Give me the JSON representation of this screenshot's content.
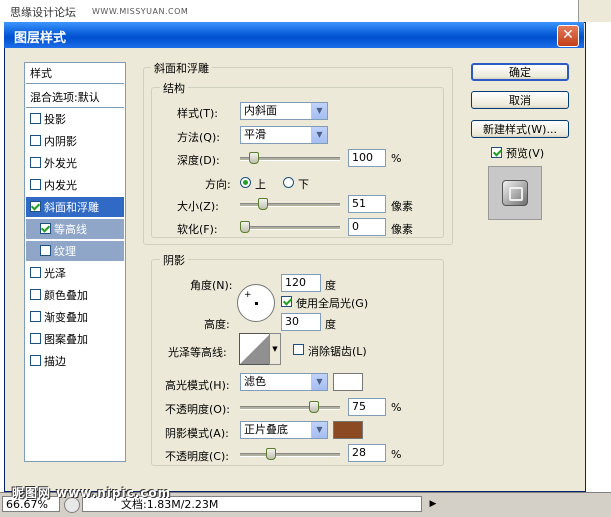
{
  "watermark": {
    "left": "思缘设计论坛",
    "right": "WWW.MISSYUAN.COM"
  },
  "dialog": {
    "title": "图层样式",
    "close_glyph": "✕"
  },
  "style_list": {
    "header": "样式",
    "blend": "混合选项:默认",
    "items": [
      {
        "label": "投影",
        "checked": false
      },
      {
        "label": "内阴影",
        "checked": false
      },
      {
        "label": "外发光",
        "checked": false
      },
      {
        "label": "内发光",
        "checked": false
      },
      {
        "label": "斜面和浮雕",
        "checked": true
      },
      {
        "label": "等高线",
        "checked": true
      },
      {
        "label": "纹理",
        "checked": false
      },
      {
        "label": "光泽",
        "checked": false
      },
      {
        "label": "颜色叠加",
        "checked": false
      },
      {
        "label": "渐变叠加",
        "checked": false
      },
      {
        "label": "图案叠加",
        "checked": false
      },
      {
        "label": "描边",
        "checked": false
      }
    ]
  },
  "buttons": {
    "ok": "确定",
    "cancel": "取消",
    "new_style": "新建样式(W)...",
    "preview": "预览(V)"
  },
  "bevel": {
    "group_title": "斜面和浮雕",
    "structure_title": "结构",
    "style_label": "样式(T):",
    "style_value": "内斜面",
    "technique_label": "方法(Q):",
    "technique_value": "平滑",
    "depth_label": "深度(D):",
    "depth_value": "100",
    "depth_unit": "%",
    "depth_level": 0.1,
    "direction_label": "方向:",
    "direction_up": "上",
    "direction_down": "下",
    "size_label": "大小(Z):",
    "size_value": "51",
    "size_unit": "像素",
    "size_level": 0.2,
    "soften_label": "软化(F):",
    "soften_value": "0",
    "soften_unit": "像素",
    "soften_level": 0.0
  },
  "shading": {
    "title": "阴影",
    "angle_label": "角度(N):",
    "angle_value": "120",
    "angle_unit": "度",
    "global_light": "使用全局光(G)",
    "altitude_label": "高度:",
    "altitude_value": "30",
    "altitude_unit": "度",
    "gloss_label": "光泽等高线:",
    "antialias": "消除锯齿(L)",
    "highlight_mode_label": "高光模式(H):",
    "highlight_mode_value": "滤色",
    "highlight_color": "#ffffff",
    "highlight_opacity_label": "不透明度(O):",
    "highlight_opacity_value": "75",
    "highlight_opacity_level": 0.75,
    "shadow_mode_label": "阴影模式(A):",
    "shadow_mode_value": "正片叠底",
    "shadow_color": "#8b4a22",
    "shadow_opacity_label": "不透明度(C):",
    "shadow_opacity_value": "28",
    "shadow_opacity_level": 0.28,
    "percent": "%"
  },
  "status": {
    "zoom": "66.67%",
    "doc": "文档:1.83M/2.23M",
    "site_watermark": "昵图网 www.nipic.com"
  }
}
